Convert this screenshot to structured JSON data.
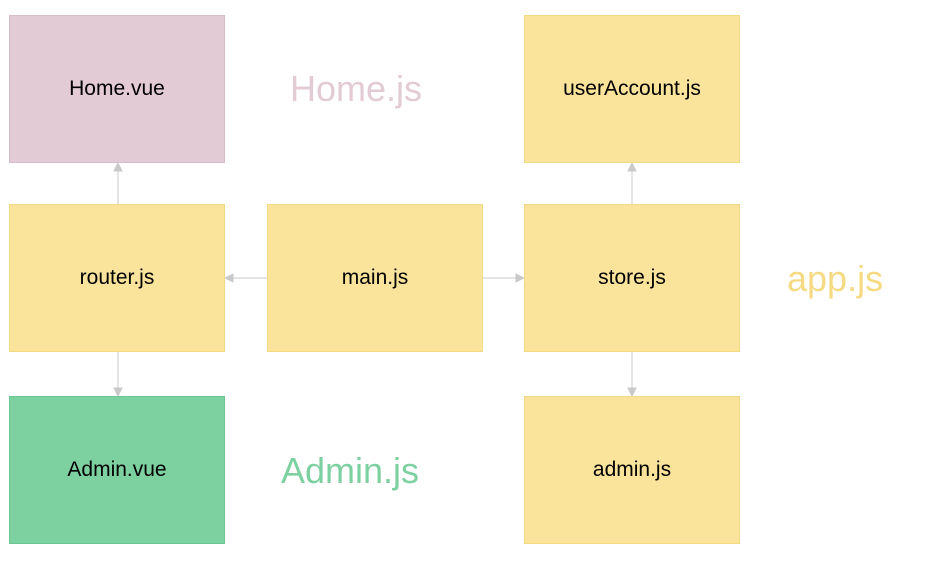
{
  "boxes": {
    "homeVue": "Home.vue",
    "userAccount": "userAccount.js",
    "router": "router.js",
    "main": "main.js",
    "store": "store.js",
    "adminVue": "Admin.vue",
    "admin": "admin.js"
  },
  "watermarks": {
    "home": "Home.js",
    "app": "app.js",
    "admin": "Admin.js"
  }
}
